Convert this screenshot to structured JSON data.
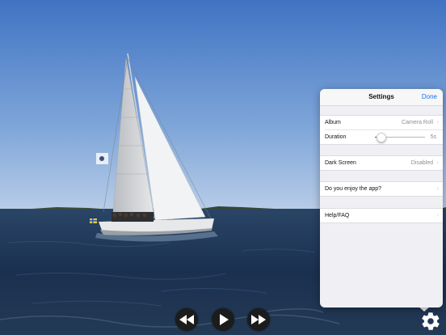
{
  "settings": {
    "title": "Settings",
    "done_label": "Done",
    "rows": {
      "album": {
        "label": "Album",
        "value": "Camera Roll"
      },
      "duration": {
        "label": "Duration",
        "value": "5s",
        "slider_fraction": 0.1
      },
      "dark_screen": {
        "label": "Dark Screen",
        "value": "Disabled"
      },
      "enjoy": {
        "label": "Do you enjoy the app?"
      },
      "help": {
        "label": "Help/FAQ"
      }
    }
  },
  "playback": {
    "rewind_icon": "rewind-icon",
    "play_icon": "play-icon",
    "fast_forward_icon": "fast-forward-icon",
    "settings_icon": "gear-icon"
  },
  "colors": {
    "accent": "#1a73e8",
    "sky_top": "#3f78c8",
    "sea": "#1c3350"
  }
}
